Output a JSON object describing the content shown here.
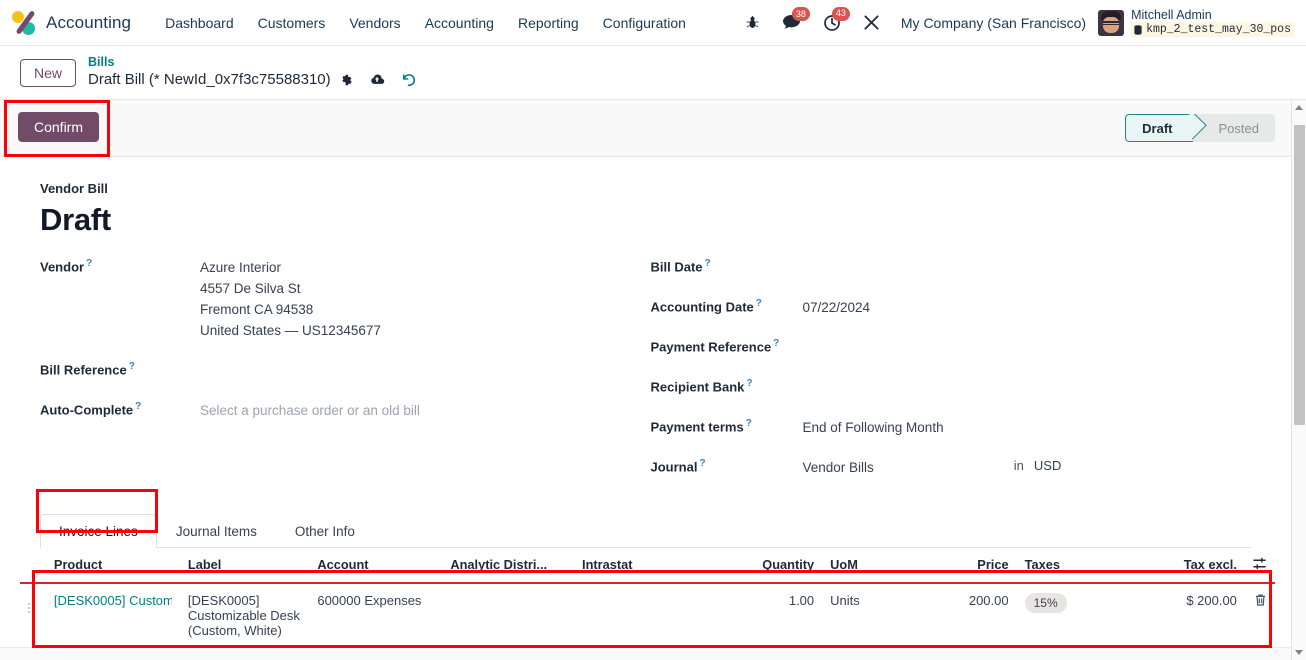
{
  "navbar": {
    "app_name": "Accounting",
    "logo_icon": "odoo-logo-icon",
    "menu": [
      {
        "label": "Dashboard"
      },
      {
        "label": "Customers"
      },
      {
        "label": "Vendors"
      },
      {
        "label": "Accounting"
      },
      {
        "label": "Reporting"
      },
      {
        "label": "Configuration"
      }
    ],
    "bug_icon": "bug-icon",
    "messages_icon": "chat-bubble-icon",
    "messages_count": "38",
    "activities_icon": "clock-icon",
    "activities_count": "43",
    "tools_icon": "wrench-screwdriver-icon",
    "company": "My Company (San Francisco)",
    "user": {
      "avatar_icon": "avatar-icon",
      "name": "Mitchell Admin",
      "database_icon": "database-icon",
      "database": "kmp_2_test_may_30_pos"
    }
  },
  "breadcrumb": {
    "new_button": "New",
    "parent": "Bills",
    "current": "Draft Bill (* NewId_0x7f3c75588310)",
    "gear_icon": "gear-icon",
    "save_icon": "cloud-upload-icon",
    "discard_icon": "undo-icon"
  },
  "action_bar": {
    "confirm_label": "Confirm",
    "status_steps": [
      {
        "label": "Draft",
        "active": true
      },
      {
        "label": "Posted",
        "active": false
      }
    ]
  },
  "form": {
    "doc_type": "Vendor Bill",
    "title": "Draft",
    "left_fields": [
      {
        "label": "Vendor",
        "help_icon": "question-mark-icon",
        "value_lines": [
          "Azure Interior",
          "4557 De Silva St",
          "Fremont CA 94538",
          "United States — US12345677"
        ],
        "placeholder": false
      },
      {
        "label": "Bill Reference",
        "help_icon": "question-mark-icon",
        "value_lines": [],
        "placeholder": false
      },
      {
        "label": "Auto-Complete",
        "help_icon": "question-mark-icon",
        "value_lines": [
          "Select a purchase order or an old bill"
        ],
        "placeholder": true
      }
    ],
    "right_fields": [
      {
        "label": "Bill Date",
        "help_icon": "question-mark-icon",
        "value": ""
      },
      {
        "label": "Accounting Date",
        "help_icon": "question-mark-icon",
        "value": "07/22/2024"
      },
      {
        "label": "Payment Reference",
        "help_icon": "question-mark-icon",
        "value": ""
      },
      {
        "label": "Recipient Bank",
        "help_icon": "question-mark-icon",
        "value": ""
      },
      {
        "label": "Payment terms",
        "help_icon": "question-mark-icon",
        "value": "End of Following Month"
      },
      {
        "label": "Journal",
        "help_icon": "question-mark-icon",
        "value": "Vendor Bills"
      }
    ],
    "journal_in": "in",
    "journal_currency": "USD"
  },
  "tabs": [
    {
      "label": "Invoice Lines",
      "active": true
    },
    {
      "label": "Journal Items",
      "active": false
    },
    {
      "label": "Other Info",
      "active": false
    }
  ],
  "lines_table": {
    "headers": [
      "Product",
      "Label",
      "Account",
      "Analytic Distri...",
      "Intrastat",
      "Quantity",
      "UoM",
      "Price",
      "Taxes",
      "Tax excl."
    ],
    "options_icon": "column-options-icon",
    "rows": [
      {
        "drag_icon": "drag-handle-icon",
        "product": "[DESK0005] Custom",
        "label": "[DESK0005] Customizable Desk (Custom, White)",
        "account": "600000 Expenses",
        "analytic": "",
        "intrastat": "",
        "quantity": "1.00",
        "uom": "Units",
        "price": "200.00",
        "taxes": "15%",
        "tax_excl": "$ 200.00",
        "delete_icon": "trash-icon"
      }
    ]
  },
  "annotations": {
    "accent_color": "#fb0007",
    "boxes": [
      "confirm-button",
      "invoice-lines-tab",
      "invoice-line-row"
    ]
  },
  "scrollbars": {
    "vertical_icon": "vertical-scrollbar",
    "horizontal_icon": "horizontal-scrollbar"
  },
  "colors": {
    "brand_purple": "#714b67",
    "teal": "#017e84",
    "badge_red": "#d9534f",
    "annotation_red": "#fb0007"
  }
}
